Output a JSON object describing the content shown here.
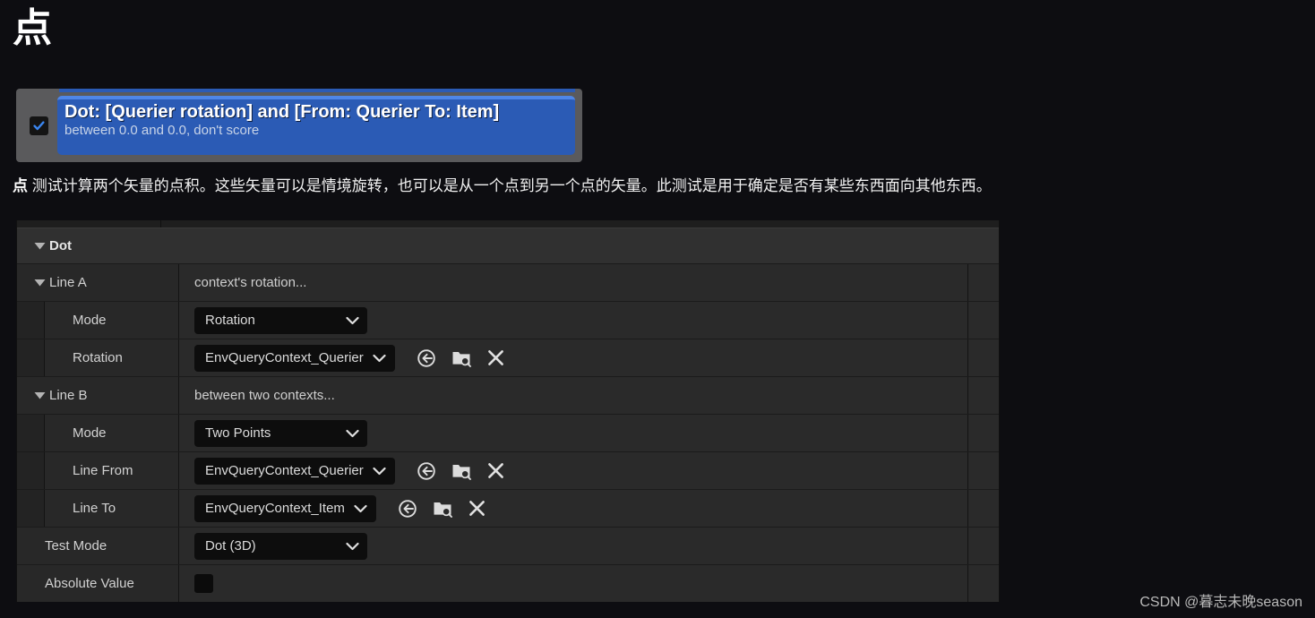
{
  "page": {
    "title": "点",
    "description_keyword": "点",
    "description_body": " 测试计算两个矢量的点积。这些矢量可以是情境旋转，也可以是从一个点到另一个点的矢量。此测试是用于确定是否有某些东西面向其他东西。",
    "watermark": "CSDN @暮志未晚season",
    "accent_color": "#2b5bb5",
    "accent_highlight_color": "#4e86e8",
    "background_color": "#0d0d11"
  },
  "test_card": {
    "checked": true,
    "title": "Dot: [Querier rotation] and [From: Querier To: Item]",
    "subtitle": "between 0.0 and 0.0, don't score"
  },
  "details": {
    "category_label": "Dot",
    "rows": [
      {
        "kind": "group",
        "label": "Line A",
        "hint": "context's rotation..."
      },
      {
        "kind": "combo",
        "label": "Mode",
        "value": "Rotation"
      },
      {
        "kind": "asset",
        "label": "Rotation",
        "value": "EnvQueryContext_Querier",
        "icons": [
          "use-selected-asset-icon",
          "browse-to-asset-icon",
          "clear-asset-icon"
        ]
      },
      {
        "kind": "group",
        "label": "Line B",
        "hint": "between two contexts..."
      },
      {
        "kind": "combo",
        "label": "Mode",
        "value": "Two Points"
      },
      {
        "kind": "asset",
        "label": "Line From",
        "value": "EnvQueryContext_Querier",
        "icons": [
          "use-selected-asset-icon",
          "browse-to-asset-icon",
          "clear-asset-icon"
        ]
      },
      {
        "kind": "asset",
        "label": "Line To",
        "value": "EnvQueryContext_Item",
        "icons": [
          "use-selected-asset-icon",
          "browse-to-asset-icon",
          "clear-asset-icon"
        ]
      },
      {
        "kind": "combo-top",
        "label": "Test Mode",
        "value": "Dot (3D)"
      },
      {
        "kind": "checkbox",
        "label": "Absolute Value",
        "checked": false
      }
    ]
  }
}
